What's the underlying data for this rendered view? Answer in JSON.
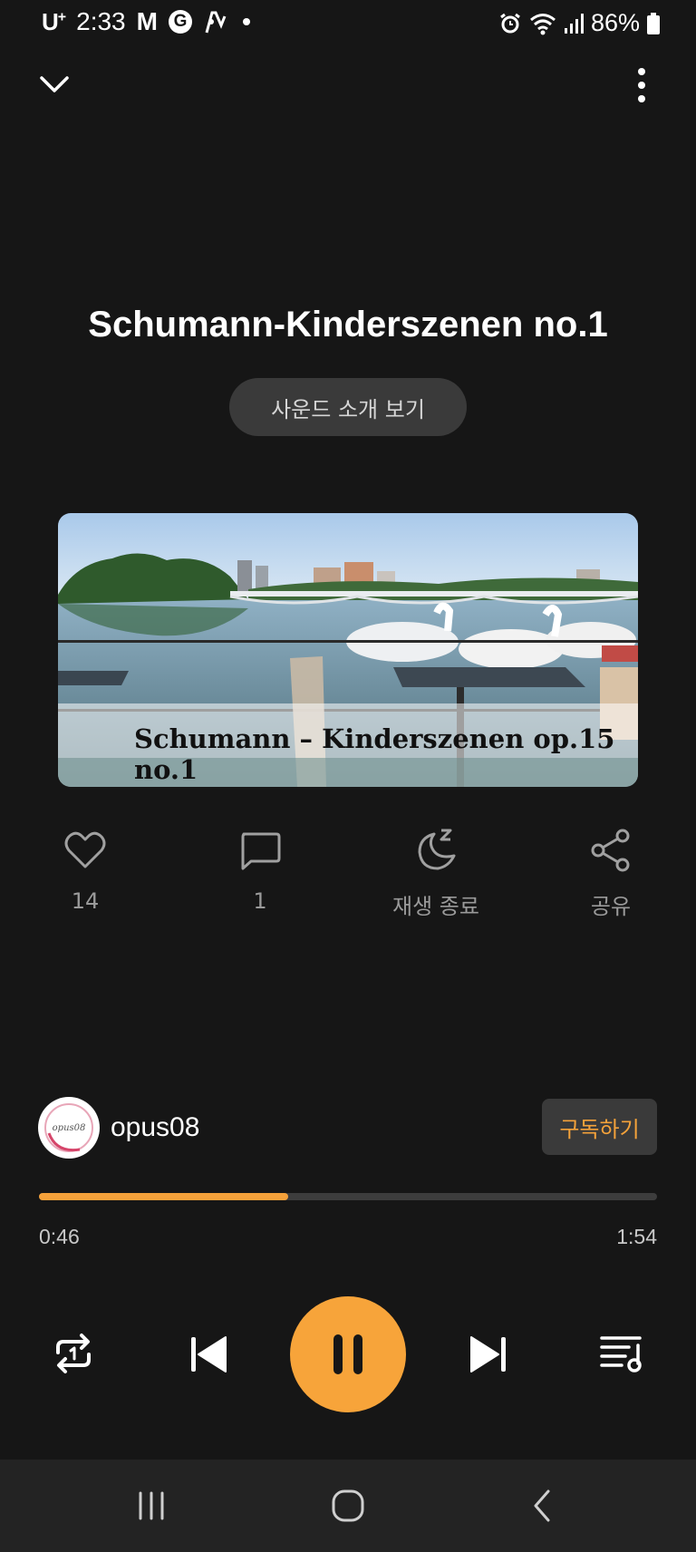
{
  "status_bar": {
    "carrier": "U",
    "carrier_sup": "+",
    "time": "2:33",
    "notif_glyphs": [
      "M",
      "G"
    ],
    "battery": "86%",
    "icons": [
      "alarm-icon",
      "wifi-icon",
      "signal-icon",
      "battery-icon"
    ]
  },
  "header": {
    "collapse_icon": "chevron-down-icon",
    "more_icon": "more-vertical-icon"
  },
  "track": {
    "title": "Schumann-Kinderszenen no.1",
    "intro_button": "사운드 소개 보기",
    "artwork_caption": "Schumann – Kinderszenen op.15 no.1"
  },
  "actions": [
    {
      "icon": "heart-icon",
      "label": "14"
    },
    {
      "icon": "comment-icon",
      "label": "1"
    },
    {
      "icon": "sleep-timer-icon",
      "label": "재생 종료"
    },
    {
      "icon": "share-icon",
      "label": "공유"
    }
  ],
  "channel": {
    "name": "opus08",
    "avatar_text": "opus08",
    "subscribe_label": "구독하기"
  },
  "playback": {
    "elapsed": "0:46",
    "total": "1:54",
    "progress": 0.4035
  },
  "controls": {
    "repeat_icon": "repeat-one-icon",
    "prev_icon": "skip-previous-icon",
    "play_pause_icon": "pause-icon",
    "next_icon": "skip-next-icon",
    "queue_icon": "playlist-icon"
  },
  "colors": {
    "accent": "#f5a13a",
    "background": "#161616"
  }
}
